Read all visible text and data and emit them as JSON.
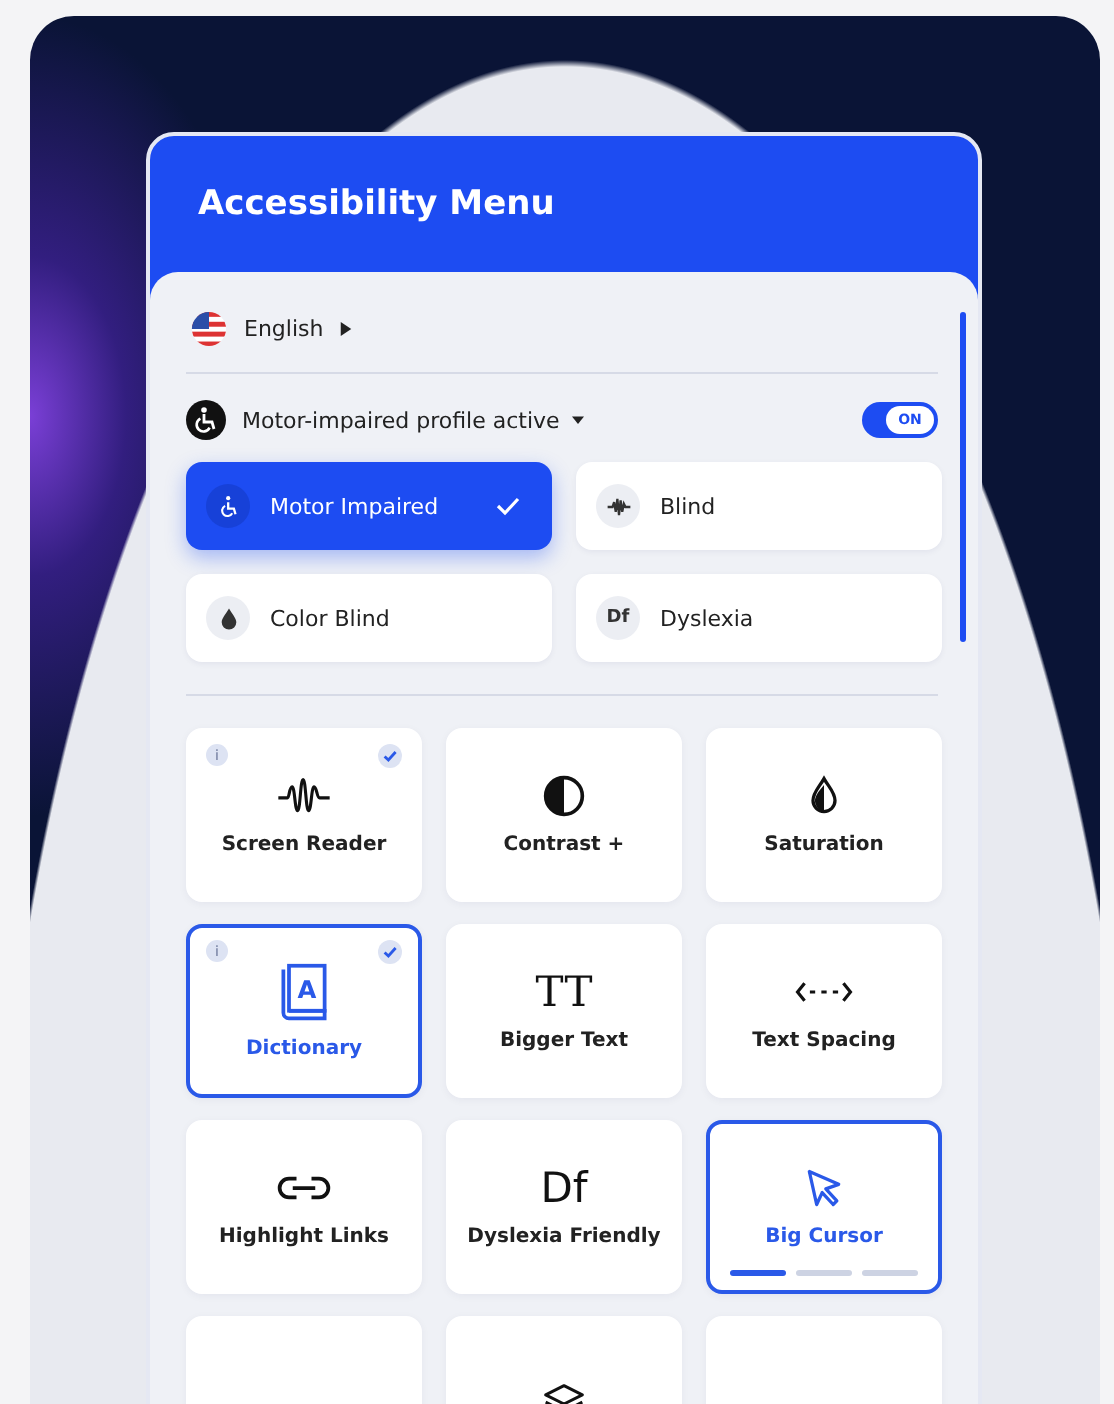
{
  "panel": {
    "title": "Accessibility Menu"
  },
  "language": {
    "label": "English"
  },
  "profile": {
    "label": "Motor-impaired profile active",
    "toggle": {
      "on": true,
      "label": "ON"
    }
  },
  "profiles": [
    {
      "label": "Motor Impaired",
      "kind": "wheelchair",
      "selected": true
    },
    {
      "label": "Blind",
      "kind": "wave",
      "selected": false
    },
    {
      "label": "Color Blind",
      "kind": "drop",
      "selected": false
    },
    {
      "label": "Dyslexia",
      "kind": "text",
      "glyph": "Df",
      "selected": false
    }
  ],
  "tiles": [
    {
      "label": "Screen Reader",
      "kind": "wave",
      "info": "i",
      "checked": true,
      "selected": false
    },
    {
      "label": "Contrast +",
      "kind": "contrast",
      "checked": false,
      "selected": false
    },
    {
      "label": "Saturation",
      "kind": "drop",
      "checked": false,
      "selected": false
    },
    {
      "label": "Dictionary",
      "kind": "book",
      "book_letter": "A",
      "info": "i",
      "checked": true,
      "selected": true
    },
    {
      "label": "Bigger Text",
      "kind": "textsize",
      "glyph": "TT",
      "checked": false,
      "selected": false
    },
    {
      "label": "Text Spacing",
      "kind": "spacing",
      "checked": false,
      "selected": false
    },
    {
      "label": "Highlight Links",
      "kind": "link",
      "checked": false,
      "selected": false
    },
    {
      "label": "Dyslexia Friendly",
      "kind": "text",
      "glyph": "Df",
      "checked": false,
      "selected": false
    },
    {
      "label": "Big Cursor",
      "kind": "cursor",
      "checked": false,
      "selected": true,
      "steps": [
        {
          "on": true
        },
        {
          "on": false
        },
        {
          "on": false
        }
      ]
    },
    {
      "kind": "blank",
      "checked": false,
      "selected": false
    },
    {
      "kind": "layers",
      "checked": false,
      "selected": false
    },
    {
      "kind": "blank",
      "checked": false,
      "selected": false
    }
  ]
}
